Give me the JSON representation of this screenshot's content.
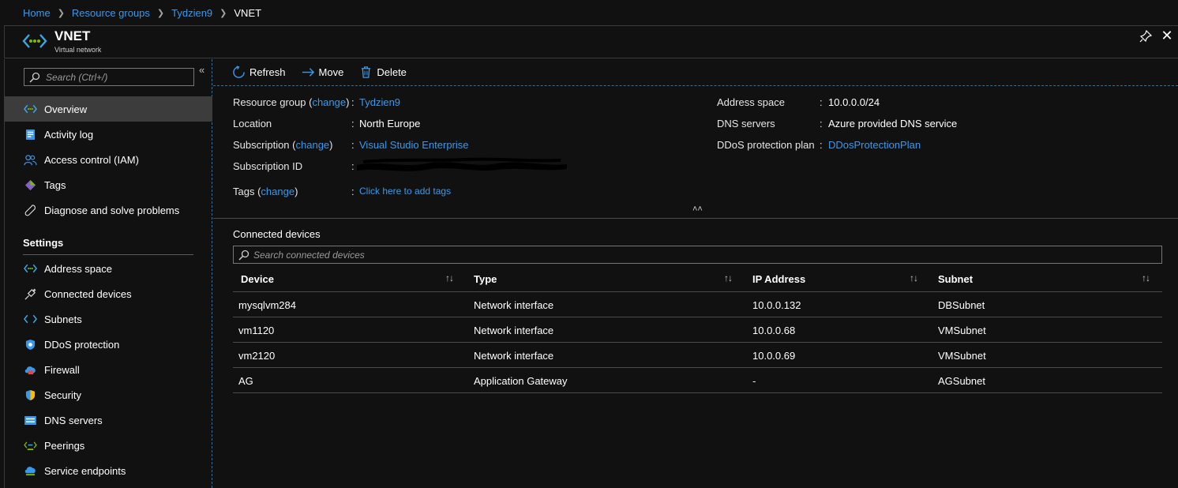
{
  "breadcrumb": {
    "items": [
      "Home",
      "Resource groups",
      "Tydzien9"
    ],
    "current": "VNET"
  },
  "header": {
    "title": "VNET",
    "subtitle": "Virtual network",
    "icon": "vnet-icon"
  },
  "sidebar": {
    "search_placeholder": "Search (Ctrl+/)",
    "items": [
      {
        "label": "Overview",
        "icon": "vnet-icon"
      },
      {
        "label": "Activity log",
        "icon": "activity-log-icon"
      },
      {
        "label": "Access control (IAM)",
        "icon": "people-icon"
      },
      {
        "label": "Tags",
        "icon": "tag-icon"
      },
      {
        "label": "Diagnose and solve problems",
        "icon": "wrench-icon"
      }
    ],
    "settings_header": "Settings",
    "settings_items": [
      {
        "label": "Address space",
        "icon": "vnet-icon"
      },
      {
        "label": "Connected devices",
        "icon": "plug-icon"
      },
      {
        "label": "Subnets",
        "icon": "subnet-icon"
      },
      {
        "label": "DDoS protection",
        "icon": "shield-icon"
      },
      {
        "label": "Firewall",
        "icon": "firewall-icon"
      },
      {
        "label": "Security",
        "icon": "security-shield-icon"
      },
      {
        "label": "DNS servers",
        "icon": "dns-icon"
      },
      {
        "label": "Peerings",
        "icon": "peerings-icon"
      },
      {
        "label": "Service endpoints",
        "icon": "cloud-endpoint-icon"
      }
    ]
  },
  "toolbar": {
    "refresh": "Refresh",
    "move": "Move",
    "delete": "Delete"
  },
  "essentials": {
    "resource_group_label": "Resource group",
    "change": "change",
    "resource_group_value": "Tydzien9",
    "location_label": "Location",
    "location_value": "North Europe",
    "subscription_label": "Subscription",
    "subscription_value": "Visual Studio Enterprise",
    "subscription_id_label": "Subscription ID",
    "tags_label": "Tags",
    "tags_value": "Click here to add tags",
    "address_space_label": "Address space",
    "address_space_value": "10.0.0.0/24",
    "dns_servers_label": "DNS servers",
    "dns_servers_value": "Azure provided DNS service",
    "ddos_label": "DDoS protection plan",
    "ddos_value": "DDosProtectionPlan"
  },
  "connected_devices": {
    "title": "Connected devices",
    "search_placeholder": "Search connected devices",
    "columns": [
      "Device",
      "Type",
      "IP Address",
      "Subnet"
    ],
    "rows": [
      [
        "mysqlvm284",
        "Network interface",
        "10.0.0.132",
        "DBSubnet"
      ],
      [
        "vm1120",
        "Network interface",
        "10.0.0.68",
        "VMSubnet"
      ],
      [
        "vm2120",
        "Network interface",
        "10.0.0.69",
        "VMSubnet"
      ],
      [
        "AG",
        "Application Gateway",
        "-",
        "AGSubnet"
      ]
    ]
  },
  "colors": {
    "accent": "#3899ec",
    "background": "#111111",
    "active_item": "#3c3c3c"
  }
}
